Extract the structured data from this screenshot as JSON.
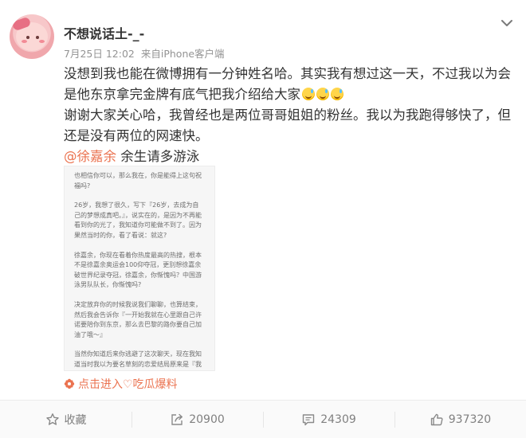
{
  "post": {
    "username": "不想说话土-_-",
    "date": "7月25日 12:02",
    "source_prefix": "来自",
    "source_device": "iPhone客户端",
    "text_para1": "没想到我也能在微博拥有一分钟姓名哈。其实我有想过这一天，不过我以为会是他东京拿完金牌有底气把我介绍给大家",
    "text_para2": "谢谢大家关心哈，我曾经也是两位哥哥姐姐的粉丝。我以为我跑得够快了，但还是没有两位的网速快。",
    "mention": "@徐嘉余",
    "mention_tail": " 余生请多游泳",
    "emoji_count": 3,
    "source_link": "点击进入♡吃瓜爆料"
  },
  "embed": {
    "paragraphs": [
      "也相信你可以，那么我在，你是能得上这句祝福吗?",
      "26岁，我想了很久，写下『26岁，去成为自己的梦想成真吧。』，说实在的，是因为不再能看到你的光了，我知道你可能做不到了。因为果然当时的你，看了看说：就这?",
      "徐嘉余，你现在看着你热度最高的热搜，根本不是徐嘉余奥运会100仰夺冠，更别想徐嘉余破世界纪录夺冠，徐嘉余，你惭愧吗？中国游泳男队队长，你惭愧吗?",
      "决定放弃你的时候我说我们聊聊，也算结束，然后我会告诉你『一开始我就在心里跟自己许诺要陪你到东京，那么去巴黎的路你要自己加油了哦～』",
      "当然你知道后来你逃避了这次聊天，现在我知道当时我以为要名草刻的恋爱结局原来是『我已经追到女神了你谁啊还来干嘛?』"
    ]
  },
  "actions": {
    "favorite": "收藏",
    "repost": "20900",
    "comment": "24309",
    "like": "937320"
  },
  "colors": {
    "link": "#eb7350",
    "meta": "#939393",
    "action_text": "#808080"
  },
  "icons": {
    "menu": "chevron-down-icon",
    "favorite": "star-icon",
    "repost": "share-icon",
    "comment": "comment-icon",
    "like": "thumbs-up-icon",
    "source": "flower-icon"
  }
}
